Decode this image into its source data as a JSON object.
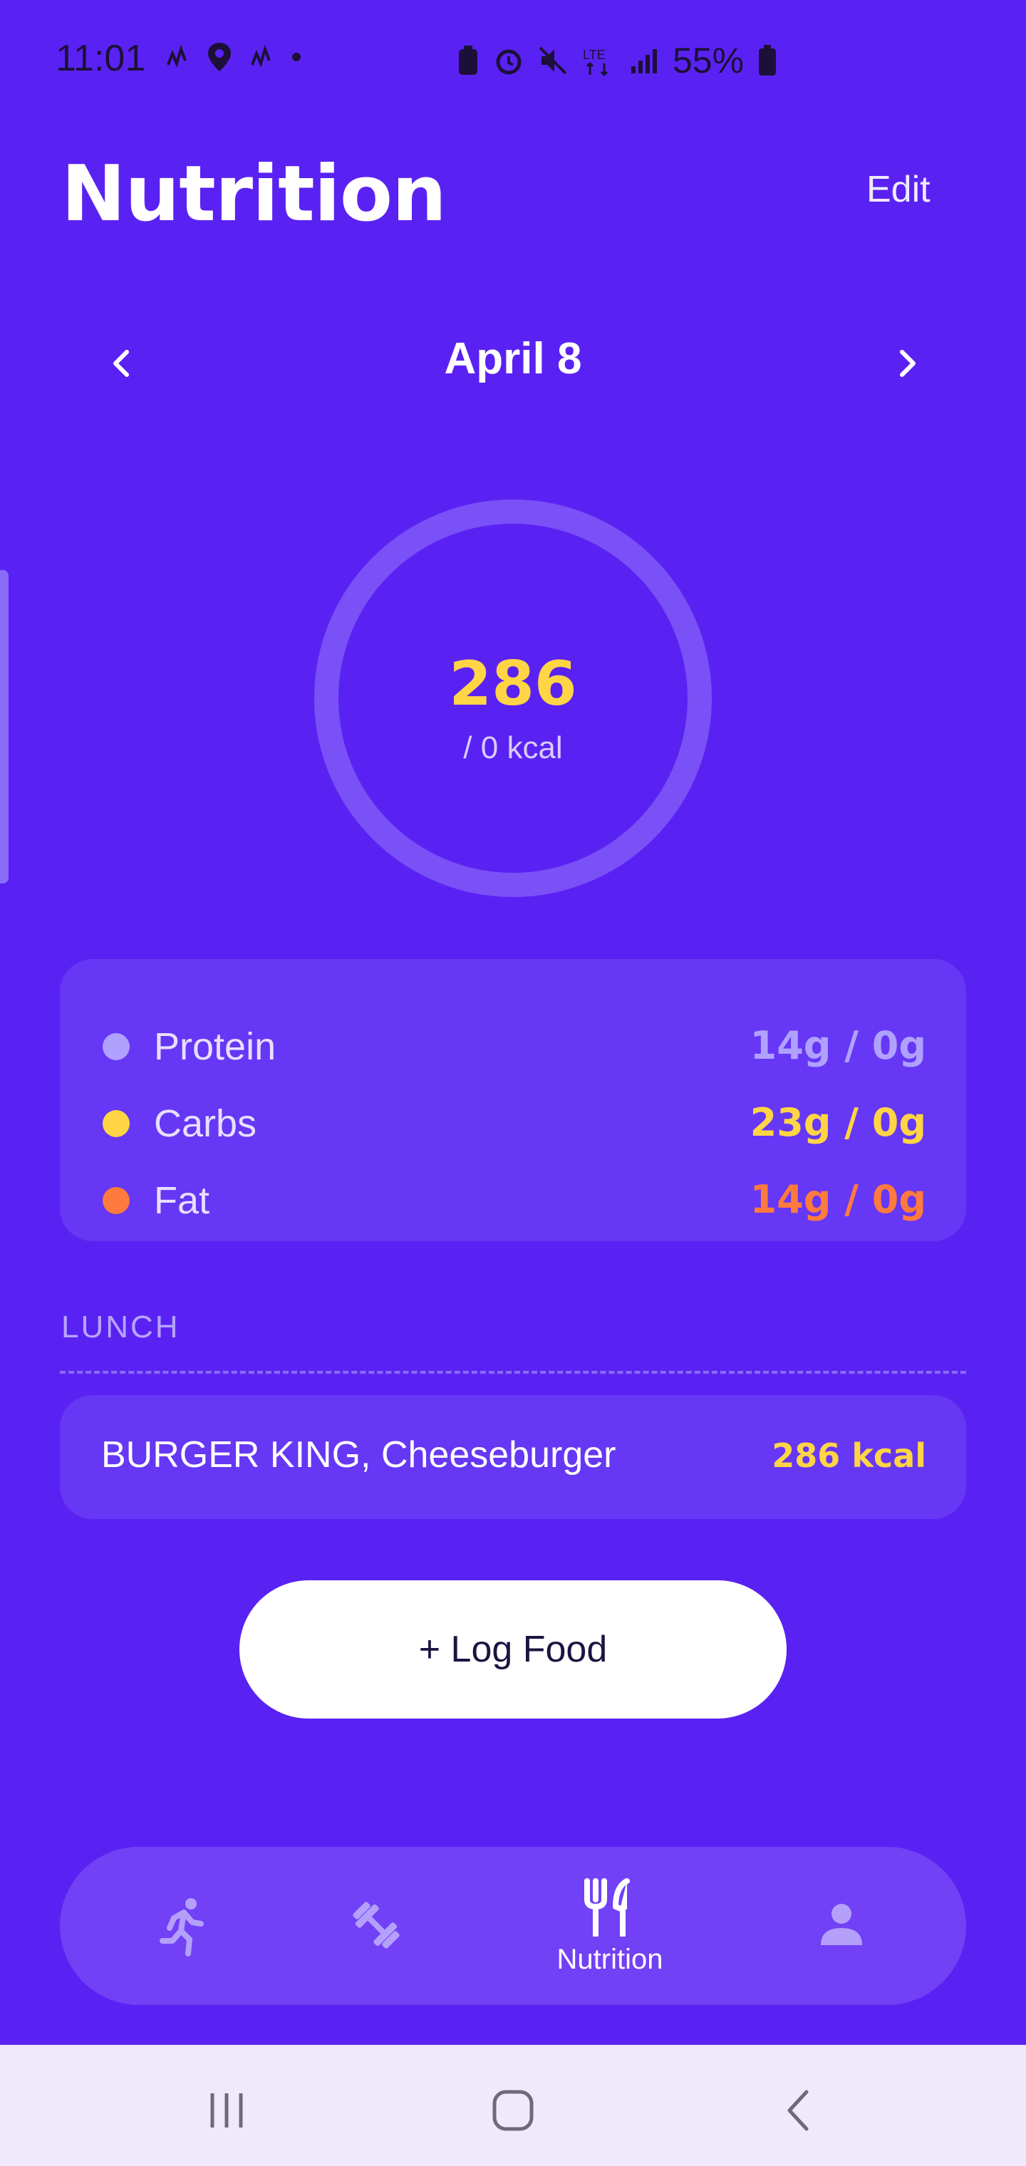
{
  "status_bar": {
    "time": "11:01",
    "battery": "55%",
    "left_icons": [
      "activity-icon",
      "location-icon",
      "activity-icon",
      "dot-icon"
    ],
    "right_icons": [
      "battery-saver-icon",
      "alarm-icon",
      "mute-icon",
      "lte-icon",
      "signal-icon",
      "battery-icon"
    ]
  },
  "header": {
    "title": "Nutrition",
    "edit_label": "Edit"
  },
  "date_nav": {
    "label": "April 8",
    "prev_icon": "chevron-left-icon",
    "next_icon": "chevron-right-icon"
  },
  "calories": {
    "value": "286",
    "goal_text": "/ 0 kcal"
  },
  "macros": [
    {
      "name": "Protein",
      "value": "14g / 0g",
      "color": "#b1a1ff"
    },
    {
      "name": "Carbs",
      "value": "23g / 0g",
      "color": "#ffd545"
    },
    {
      "name": "Fat",
      "value": "14g / 0g",
      "color": "#ff7a3d"
    }
  ],
  "meals": [
    {
      "section": "LUNCH",
      "items": [
        {
          "name": "BURGER KING, Cheeseburger",
          "kcal": "286 kcal"
        }
      ]
    }
  ],
  "log_food_label": "+ Log Food",
  "bottom_nav": {
    "items": [
      {
        "icon": "running-icon",
        "label": "",
        "active": false
      },
      {
        "icon": "dumbbell-icon",
        "label": "",
        "active": false
      },
      {
        "icon": "fork-knife-icon",
        "label": "Nutrition",
        "active": true
      },
      {
        "icon": "profile-icon",
        "label": "",
        "active": false
      }
    ]
  },
  "system_nav": [
    "recents-icon",
    "home-icon",
    "back-icon"
  ],
  "colors": {
    "background": "#5a22f2",
    "card": "#6637f4",
    "accent_yellow": "#ffd545",
    "accent_orange": "#ff7a3d",
    "protein": "#b1a1ff"
  }
}
